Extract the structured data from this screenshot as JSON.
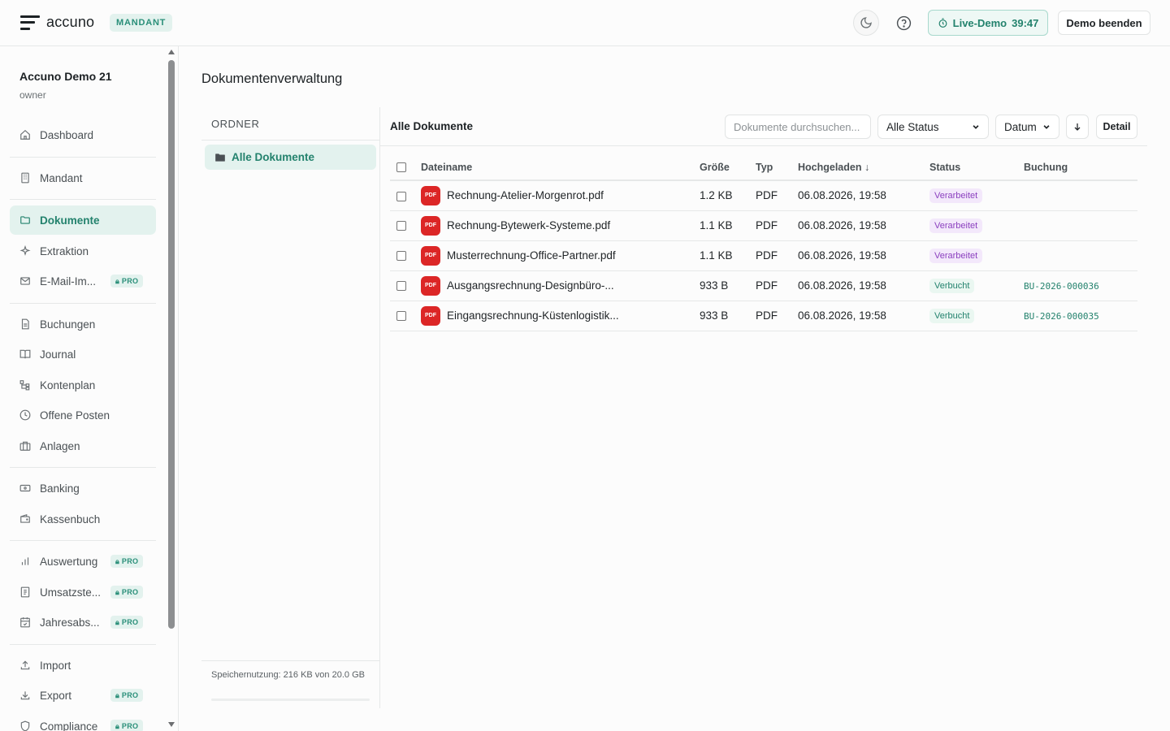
{
  "header": {
    "app_name": "accuno",
    "mode_badge": "MANDANT",
    "theme_toggle": "moon-icon",
    "help": "help-icon",
    "live_demo_label": "Live-Demo",
    "live_demo_timer": "39:47",
    "end_demo_label": "Demo beenden"
  },
  "sidebar": {
    "tenant_name": "Accuno Demo 21",
    "tenant_role": "owner",
    "pro_label": "PRO",
    "items": [
      {
        "label": "Dashboard",
        "icon": "home-icon"
      },
      {
        "label": "Mandant",
        "icon": "building-icon"
      },
      {
        "label": "Dokumente",
        "icon": "folder-icon",
        "active": true
      },
      {
        "label": "Extraktion",
        "icon": "sparkles-icon"
      },
      {
        "label": "E-Mail-Im...",
        "icon": "mail-icon",
        "pro": true
      },
      {
        "label": "Buchungen",
        "icon": "file-text-icon"
      },
      {
        "label": "Journal",
        "icon": "book-open-icon"
      },
      {
        "label": "Kontenplan",
        "icon": "hierarchy-icon"
      },
      {
        "label": "Offene Posten",
        "icon": "clock-icon"
      },
      {
        "label": "Anlagen",
        "icon": "briefcase-icon"
      },
      {
        "label": "Banking",
        "icon": "banknote-icon"
      },
      {
        "label": "Kassenbuch",
        "icon": "wallet-icon"
      },
      {
        "label": "Auswertung",
        "icon": "bar-chart-icon",
        "pro": true
      },
      {
        "label": "Umsatzste...",
        "icon": "receipt-icon",
        "pro": true
      },
      {
        "label": "Jahresabs...",
        "icon": "calendar-check-icon",
        "pro": true
      },
      {
        "label": "Import",
        "icon": "upload-icon"
      },
      {
        "label": "Export",
        "icon": "download-icon",
        "pro": true
      },
      {
        "label": "Compliance",
        "icon": "shield-icon",
        "pro": true
      }
    ]
  },
  "main": {
    "title": "Dokumentenverwaltung",
    "folders_heading": "ORDNER",
    "folders": [
      {
        "label": "Alle Dokumente",
        "active": true
      }
    ],
    "storage_text": "Speichernutzung: 216 KB von 20.0 GB",
    "storage_fraction": 1e-05,
    "docs_title": "Alle Dokumente",
    "search_placeholder": "Dokumente durchsuchen...",
    "status_filter": "Alle Status",
    "sort_field": "Datum",
    "detail_label": "Detail",
    "table": {
      "columns": [
        "Dateiname",
        "Größe",
        "Typ",
        "Hochgeladen",
        "Status",
        "Buchung"
      ],
      "sort_indicator": "↓",
      "file_icon_label": "PDF",
      "rows": [
        {
          "name": "Rechnung-Atelier-Morgenrot.pdf",
          "size": "1.2 KB",
          "type": "PDF",
          "uploaded": "06.08.2026, 19:58",
          "status": "Verarbeitet",
          "booking": ""
        },
        {
          "name": "Rechnung-Bytewerk-Systeme.pdf",
          "size": "1.1 KB",
          "type": "PDF",
          "uploaded": "06.08.2026, 19:58",
          "status": "Verarbeitet",
          "booking": ""
        },
        {
          "name": "Musterrechnung-Office-Partner.pdf",
          "size": "1.1 KB",
          "type": "PDF",
          "uploaded": "06.08.2026, 19:58",
          "status": "Verarbeitet",
          "booking": ""
        },
        {
          "name": "Ausgangsrechnung-Designbüro-...",
          "size": "933 B",
          "type": "PDF",
          "uploaded": "06.08.2026, 19:58",
          "status": "Verbucht",
          "booking": "BU-2026-000036"
        },
        {
          "name": "Eingangsrechnung-Küstenlogistik...",
          "size": "933 B",
          "type": "PDF",
          "uploaded": "06.08.2026, 19:58",
          "status": "Verbucht",
          "booking": "BU-2026-000035"
        }
      ]
    }
  },
  "colors": {
    "accent": "#2a8f79",
    "accent_bg": "#e3f2ee",
    "pdf_red": "#dc2626",
    "status_processed": "#8b3fbf",
    "status_booked": "#23826d"
  }
}
